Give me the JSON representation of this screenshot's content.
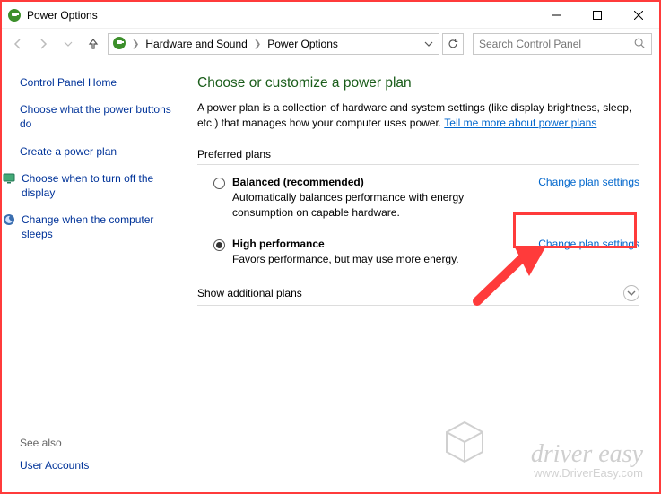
{
  "window": {
    "title": "Power Options"
  },
  "breadcrumb": {
    "item1": "Hardware and Sound",
    "item2": "Power Options"
  },
  "search": {
    "placeholder": "Search Control Panel"
  },
  "sidebar": {
    "home": "Control Panel Home",
    "link1": "Choose what the power buttons do",
    "link2": "Create a power plan",
    "link3": "Choose when to turn off the display",
    "link4": "Change when the computer sleeps",
    "see_also_label": "See also",
    "user_accounts": "User Accounts"
  },
  "main": {
    "heading": "Choose or customize a power plan",
    "desc_text": "A power plan is a collection of hardware and system settings (like display brightness, sleep, etc.) that manages how your computer uses power. ",
    "desc_link": "Tell me more about power plans",
    "preferred_label": "Preferred plans",
    "plan1": {
      "title": "Balanced (recommended)",
      "desc": "Automatically balances performance with energy consumption on capable hardware.",
      "settings": "Change plan settings"
    },
    "plan2": {
      "title": "High performance",
      "desc": "Favors performance, but may use more energy.",
      "settings": "Change plan settings"
    },
    "show_additional": "Show additional plans"
  },
  "watermark": {
    "brand": "driver easy",
    "url": "www.DriverEasy.com"
  }
}
